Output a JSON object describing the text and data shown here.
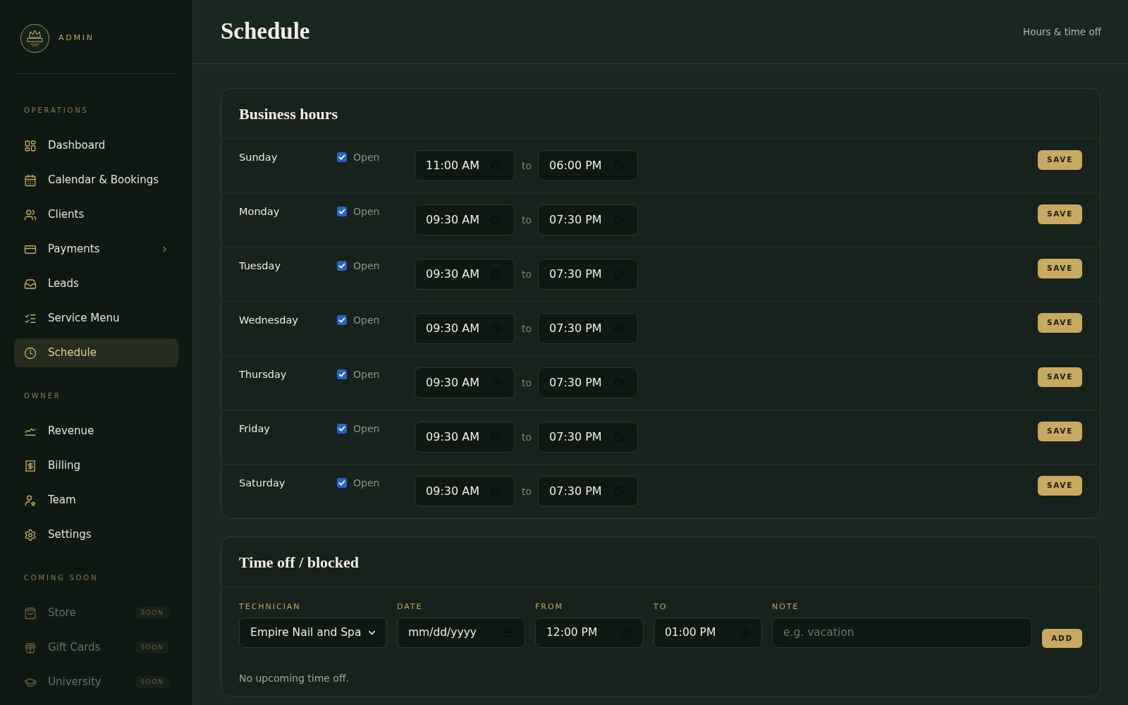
{
  "sidebar": {
    "brand": {
      "label": "ADMIN"
    },
    "sections": [
      {
        "title": "OPERATIONS",
        "items": [
          {
            "label": "Dashboard",
            "selected": false,
            "disabled": false,
            "submenu": false
          },
          {
            "label": "Calendar & Bookings",
            "selected": false,
            "disabled": false,
            "submenu": false
          },
          {
            "label": "Clients",
            "selected": false,
            "disabled": false,
            "submenu": false
          },
          {
            "label": "Payments",
            "selected": false,
            "disabled": false,
            "submenu": true
          },
          {
            "label": "Leads",
            "selected": false,
            "disabled": false,
            "submenu": false
          },
          {
            "label": "Service Menu",
            "selected": false,
            "disabled": false,
            "submenu": false
          },
          {
            "label": "Schedule",
            "selected": true,
            "disabled": false,
            "submenu": false
          }
        ]
      },
      {
        "title": "OWNER",
        "items": [
          {
            "label": "Revenue",
            "selected": false,
            "disabled": false,
            "submenu": false
          },
          {
            "label": "Billing",
            "selected": false,
            "disabled": false,
            "submenu": false
          },
          {
            "label": "Team",
            "selected": false,
            "disabled": false,
            "submenu": false
          },
          {
            "label": "Settings",
            "selected": false,
            "disabled": false,
            "submenu": false
          }
        ]
      },
      {
        "title": "COMING SOON",
        "items": [
          {
            "label": "Store",
            "selected": false,
            "disabled": true,
            "submenu": false,
            "badge": "SOON"
          },
          {
            "label": "Gift Cards",
            "selected": false,
            "disabled": true,
            "submenu": false,
            "badge": "SOON"
          },
          {
            "label": "University",
            "selected": false,
            "disabled": true,
            "submenu": false,
            "badge": "SOON"
          }
        ]
      }
    ]
  },
  "header": {
    "title": "Schedule",
    "subtitle": "Hours & time off"
  },
  "business_hours": {
    "title": "Business hours",
    "days": [
      {
        "day": "Sunday",
        "open": true,
        "open_label": "Open",
        "from": "11:00 AM",
        "separator": "to",
        "to": "06:00 PM",
        "action": "SAVE"
      },
      {
        "day": "Monday",
        "open": true,
        "open_label": "Open",
        "from": "09:30 AM",
        "separator": "to",
        "to": "07:30 PM",
        "action": "SAVE"
      },
      {
        "day": "Tuesday",
        "open": true,
        "open_label": "Open",
        "from": "09:30 AM",
        "separator": "to",
        "to": "07:30 PM",
        "action": "SAVE"
      },
      {
        "day": "Wednesday",
        "open": true,
        "open_label": "Open",
        "from": "09:30 AM",
        "separator": "to",
        "to": "07:30 PM",
        "action": "SAVE"
      },
      {
        "day": "Thursday",
        "open": true,
        "open_label": "Open",
        "from": "09:30 AM",
        "separator": "to",
        "to": "07:30 PM",
        "action": "SAVE"
      },
      {
        "day": "Friday",
        "open": true,
        "open_label": "Open",
        "from": "09:30 AM",
        "separator": "to",
        "to": "07:30 PM",
        "action": "SAVE"
      },
      {
        "day": "Saturday",
        "open": true,
        "open_label": "Open",
        "from": "09:30 AM",
        "separator": "to",
        "to": "07:30 PM",
        "action": "SAVE"
      }
    ]
  },
  "time_off": {
    "title": "Time off / blocked",
    "fields": [
      {
        "label": "TECHNICIAN",
        "kind": "select",
        "value": "Empire Nail and Spa"
      },
      {
        "label": "DATE",
        "kind": "date",
        "placeholder": "mm/dd/yyyy"
      },
      {
        "label": "FROM",
        "kind": "time",
        "value": "12:00 PM"
      },
      {
        "label": "TO",
        "kind": "time",
        "value": "01:00 PM"
      },
      {
        "label": "NOTE",
        "kind": "text",
        "placeholder": "e.g. vacation"
      }
    ],
    "action": "ADD",
    "empty_message": "No upcoming time off."
  }
}
